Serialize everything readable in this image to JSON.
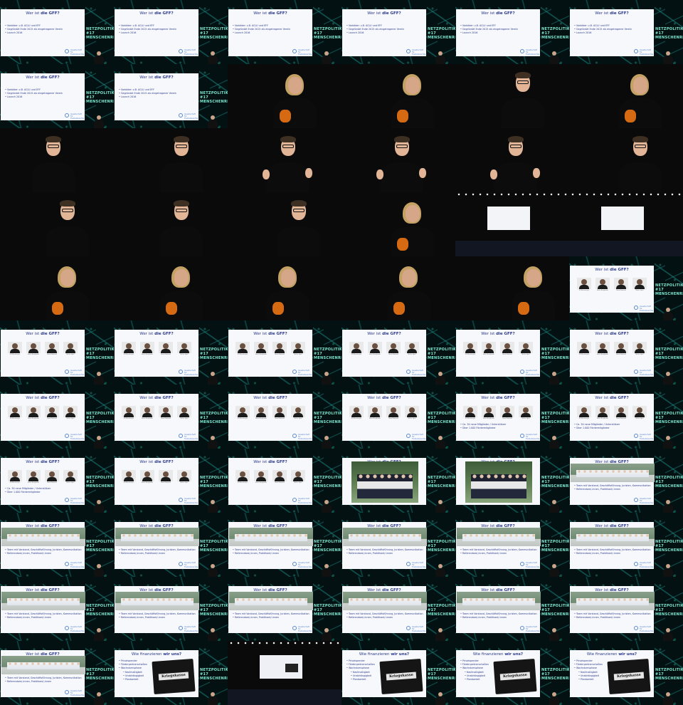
{
  "slides": {
    "wer_title_plain": "Wer ist ",
    "wer_title_bold": "die GFF?",
    "wer_lines": [
      "Vorbilder: z.B. ACLU und EFF",
      "Gegründet Ende 2015 als eingetragener Verein",
      "Launch 2016"
    ],
    "founders_lines": [
      "Ca. 30 neue Mitglieder / Unterstützer",
      "Über 1.000 Fördermitglieder"
    ],
    "team_lines": [
      "Team mit Vorstand, Geschäftsführung, Juristen, Kommunikation",
      "Referendare/-innen, Praktikant/-innen"
    ],
    "portrait_captions": [
      "Ulf Buermeyer",
      "Boris Burghardt",
      "Nora Markard",
      "Malte Spitz"
    ],
    "fin_title_plain": "Wie finanzieren ",
    "fin_title_bold": "wir uns?",
    "fin_lines": [
      "Privatspender",
      "Förderpartnerschaften",
      "Wachstumsphase"
    ],
    "fin_sublines": [
      "Nachhaltigkeit",
      "Unabhängigkeit",
      "Planbarkeit"
    ],
    "box_label": "Kriegskasse",
    "logo_line1": "Gesellschaft für",
    "logo_line2": "Freiheitsrechte",
    "conference_logo": [
      "NETZPOLITIK",
      "#17",
      "MENSCHENRECHTE"
    ]
  },
  "thumbnails": [
    {
      "type": "wer"
    },
    {
      "type": "wer"
    },
    {
      "type": "wer"
    },
    {
      "type": "wer"
    },
    {
      "type": "wer"
    },
    {
      "type": "wer"
    },
    {
      "type": "wer"
    },
    {
      "type": "wer"
    },
    {
      "type": "woman",
      "pose": "profile"
    },
    {
      "type": "woman",
      "pose": "front"
    },
    {
      "type": "man",
      "pose": "side"
    },
    {
      "type": "woman",
      "pose": "front"
    },
    {
      "type": "man",
      "pose": "left"
    },
    {
      "type": "man",
      "pose": "side"
    },
    {
      "type": "man",
      "pose": "gesture"
    },
    {
      "type": "man",
      "pose": "gesture"
    },
    {
      "type": "man",
      "pose": "gesture"
    },
    {
      "type": "man",
      "pose": "front"
    },
    {
      "type": "man",
      "pose": "side"
    },
    {
      "type": "man",
      "pose": "side"
    },
    {
      "type": "man",
      "pose": "front"
    },
    {
      "type": "woman",
      "pose": "front"
    },
    {
      "type": "stage"
    },
    {
      "type": "stage"
    },
    {
      "type": "woman",
      "pose": "profile"
    },
    {
      "type": "woman",
      "pose": "profile"
    },
    {
      "type": "woman",
      "pose": "gesture"
    },
    {
      "type": "woman",
      "pose": "profile"
    },
    {
      "type": "woman",
      "pose": "back"
    },
    {
      "type": "founders"
    },
    {
      "type": "founders"
    },
    {
      "type": "founders"
    },
    {
      "type": "founders"
    },
    {
      "type": "founders"
    },
    {
      "type": "founders"
    },
    {
      "type": "founders"
    },
    {
      "type": "founders"
    },
    {
      "type": "founders"
    },
    {
      "type": "founders"
    },
    {
      "type": "founders"
    },
    {
      "type": "founders_text"
    },
    {
      "type": "founders_text"
    },
    {
      "type": "founders_text"
    },
    {
      "type": "founders"
    },
    {
      "type": "founders"
    },
    {
      "type": "bigphoto"
    },
    {
      "type": "bigphoto"
    },
    {
      "type": "team"
    },
    {
      "type": "team"
    },
    {
      "type": "team"
    },
    {
      "type": "team"
    },
    {
      "type": "team"
    },
    {
      "type": "team"
    },
    {
      "type": "team"
    },
    {
      "type": "team"
    },
    {
      "type": "team"
    },
    {
      "type": "team"
    },
    {
      "type": "team"
    },
    {
      "type": "team"
    },
    {
      "type": "team"
    },
    {
      "type": "team"
    },
    {
      "type": "finance"
    },
    {
      "type": "stage_fin"
    },
    {
      "type": "finance"
    },
    {
      "type": "finance"
    },
    {
      "type": "finance"
    }
  ]
}
